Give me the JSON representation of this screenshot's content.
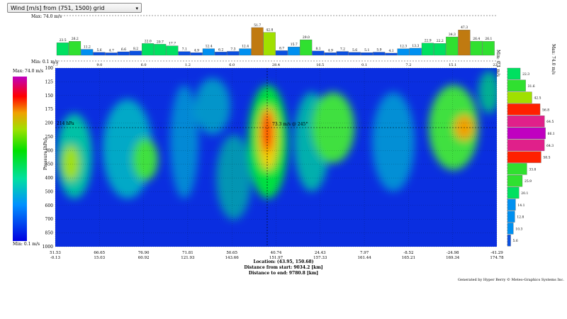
{
  "dropdown": {
    "label": "Wind [m/s] from (751, 1500) grid"
  },
  "top_panel": {
    "max_label": "Max: 74.0 m/s",
    "min_label": "Min: 0.1 m/s"
  },
  "right_panel": {
    "min_label": "Min: 0.1 m/s",
    "max_label": "Max: 74.0 m/s"
  },
  "colorbar": {
    "max_label": "Max: 74.0 m/s",
    "min_label": "Min: 0.1 m/s"
  },
  "annotations": {
    "level_label": "214 hPa",
    "cursor_label": "73.3 m/s @ 245°"
  },
  "footer": {
    "location": "Location: (43.95, 150.68)",
    "from_start": "Distance from start: 9034.2 [km]",
    "to_end": "Distance to end: 9780.8 [km]",
    "generated": "Generated by Hyper Berry © Meteo-Graphics Systems Inc."
  },
  "colors": {
    "weak": "#0000ff",
    "mid": "#00ff00",
    "strong": "#ff0000",
    "extreme": "#c000c0"
  },
  "chart_data": [
    {
      "type": "bar",
      "title": "Maximum wind along cross-section",
      "values": [
        23.5,
        26.2,
        11.2,
        5.6,
        4.7,
        6.6,
        8.2,
        22.0,
        20.7,
        17.7,
        7.1,
        4.9,
        12.4,
        6.2,
        7.3,
        12.4,
        51.7,
        42.8,
        8.7,
        15.7,
        29.0,
        8.1,
        4.9,
        7.2,
        5.6,
        5.1,
        5.9,
        4.1,
        12.3,
        13.3,
        22.9,
        22.2,
        34.3,
        47.3,
        26.4,
        26.1
      ],
      "ylim": [
        0,
        74
      ]
    },
    {
      "type": "heatmap",
      "ylabel": "Pressure [hPa]",
      "y_ticks": [
        "100",
        "125",
        "150",
        "175",
        "200",
        "250",
        "300",
        "350",
        "400",
        "500",
        "600",
        "700",
        "850",
        "1000"
      ],
      "x_ticks_top": [
        "7.7",
        "9.0",
        "6.0",
        "1.2",
        "6.0",
        "28.4",
        "16.5",
        "0.1",
        "7.2",
        "15.1",
        "22.7"
      ],
      "x_ticks_bottom": [
        {
          "lat": "51.53",
          "dist": "-0.13"
        },
        {
          "lat": "66.65",
          "dist": "15.03"
        },
        {
          "lat": "76.90",
          "dist": "60.92"
        },
        {
          "lat": "71.81",
          "dist": "121.93"
        },
        {
          "lat": "50.65",
          "dist": "143.66"
        },
        {
          "lat": "40.74",
          "dist": "151.97"
        },
        {
          "lat": "24.43",
          "dist": "157.33"
        },
        {
          "lat": "7.97",
          "dist": "161.44"
        },
        {
          "lat": "-8.52",
          "dist": "165.21"
        },
        {
          "lat": "-24.98",
          "dist": "169.34"
        },
        {
          "lat": "-41.29",
          "dist": "174.78"
        }
      ],
      "crosshair": {
        "pressure": 214,
        "speed": 73.3,
        "direction": 245
      }
    },
    {
      "type": "bar",
      "title": "Wind speed profile by level",
      "values": [
        5.6,
        10.3,
        12.8,
        14.1,
        20.1,
        25.9,
        33.8,
        58.5,
        64.3,
        66.1,
        64.5,
        56.8,
        42.5,
        31.6,
        22.3
      ],
      "xlim": [
        0,
        74
      ]
    }
  ]
}
